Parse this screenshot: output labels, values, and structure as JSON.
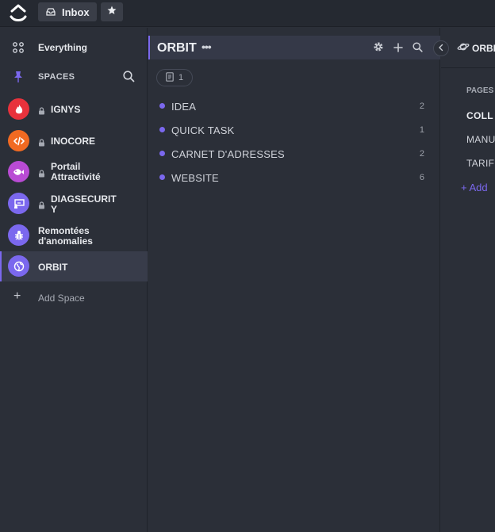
{
  "topbar": {
    "inbox_label": "Inbox"
  },
  "sidebar": {
    "everything_label": "Everything",
    "spaces_label": "SPACES",
    "add_space_label": "Add Space",
    "spaces": [
      {
        "line1": "IGNYS",
        "line2": "",
        "locked": true,
        "color": "#e8323c",
        "icon": "flame-icon"
      },
      {
        "line1": "INOCORE",
        "line2": "",
        "locked": true,
        "color": "#f16a22",
        "icon": "code-icon"
      },
      {
        "line1": "Portail",
        "line2": "Attractivité",
        "locked": true,
        "color": "#b94bd4",
        "icon": "fish-icon"
      },
      {
        "line1": "DIAGSECURIT",
        "line2": "Y",
        "locked": true,
        "color": "#7b68ee",
        "icon": "presentation-icon"
      },
      {
        "line1": "Remontées",
        "line2": "d'anomalies",
        "locked": false,
        "color": "#7b68ee",
        "icon": "bug-icon"
      },
      {
        "line1": "ORBIT",
        "line2": "",
        "locked": false,
        "color": "#7b68ee",
        "icon": "globe-icon"
      }
    ]
  },
  "middle": {
    "title": "ORBIT",
    "dots": "•••",
    "pages_count": "1",
    "lists": [
      {
        "name": "IDEA",
        "count": "2"
      },
      {
        "name": "QUICK TASK",
        "count": "1"
      },
      {
        "name": "CARNET D'ADRESSES",
        "count": "2"
      },
      {
        "name": "WEBSITE",
        "count": "6"
      }
    ]
  },
  "right": {
    "title": "ORBIT",
    "pages_label": "PAGES",
    "items": [
      "COLL",
      "MANU",
      "TARIF"
    ],
    "add_label": "+ Add"
  },
  "colors": {
    "accent": "#7b68ee",
    "background": "#2b2f38",
    "topbar": "#252931"
  }
}
